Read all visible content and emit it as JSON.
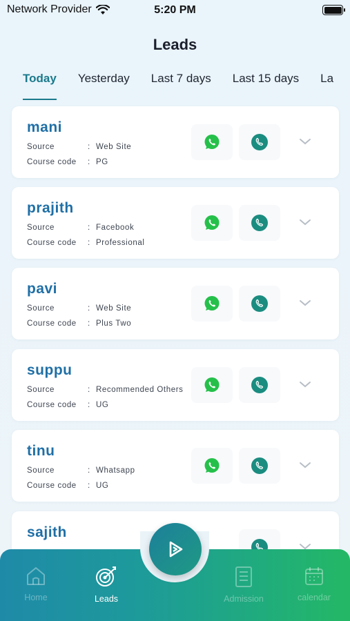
{
  "status_bar": {
    "carrier": "Network Provider",
    "time": "5:20 PM"
  },
  "header": {
    "title": "Leads"
  },
  "tabs": [
    {
      "label": "Today",
      "active": true
    },
    {
      "label": "Yesterday",
      "active": false
    },
    {
      "label": "Last 7 days",
      "active": false
    },
    {
      "label": "Last 15 days",
      "active": false
    },
    {
      "label": "La",
      "active": false
    }
  ],
  "field_labels": {
    "source": "Source",
    "course_code": "Course code",
    "separator": ":"
  },
  "leads": [
    {
      "name": "mani",
      "source": "Web Site",
      "course_code": "PG"
    },
    {
      "name": "prajith",
      "source": "Facebook",
      "course_code": "Professional"
    },
    {
      "name": "pavi",
      "source": "Web Site",
      "course_code": "Plus Two"
    },
    {
      "name": "suppu",
      "source": "Recommended Others",
      "course_code": "UG"
    },
    {
      "name": "tinu",
      "source": "Whatsapp",
      "course_code": "UG"
    },
    {
      "name": "sajith",
      "source": "",
      "course_code": ""
    }
  ],
  "bottom_nav": {
    "items": [
      {
        "label": "Home",
        "icon": "home-icon",
        "active": false
      },
      {
        "label": "Leads",
        "icon": "target-icon",
        "active": true
      },
      {
        "label": "Admission",
        "icon": "clipboard-icon",
        "active": false
      },
      {
        "label": "calendar",
        "icon": "calendar-icon",
        "active": false
      }
    ],
    "fab_icon": "play-icon"
  },
  "colors": {
    "accent": "#1a7a8c",
    "lead_name": "#1f6fa6",
    "whatsapp_green": "#25c04a",
    "call_teal": "#1b8c80",
    "nav_gradient_start": "#1f8aa8",
    "nav_gradient_end": "#24b865"
  }
}
